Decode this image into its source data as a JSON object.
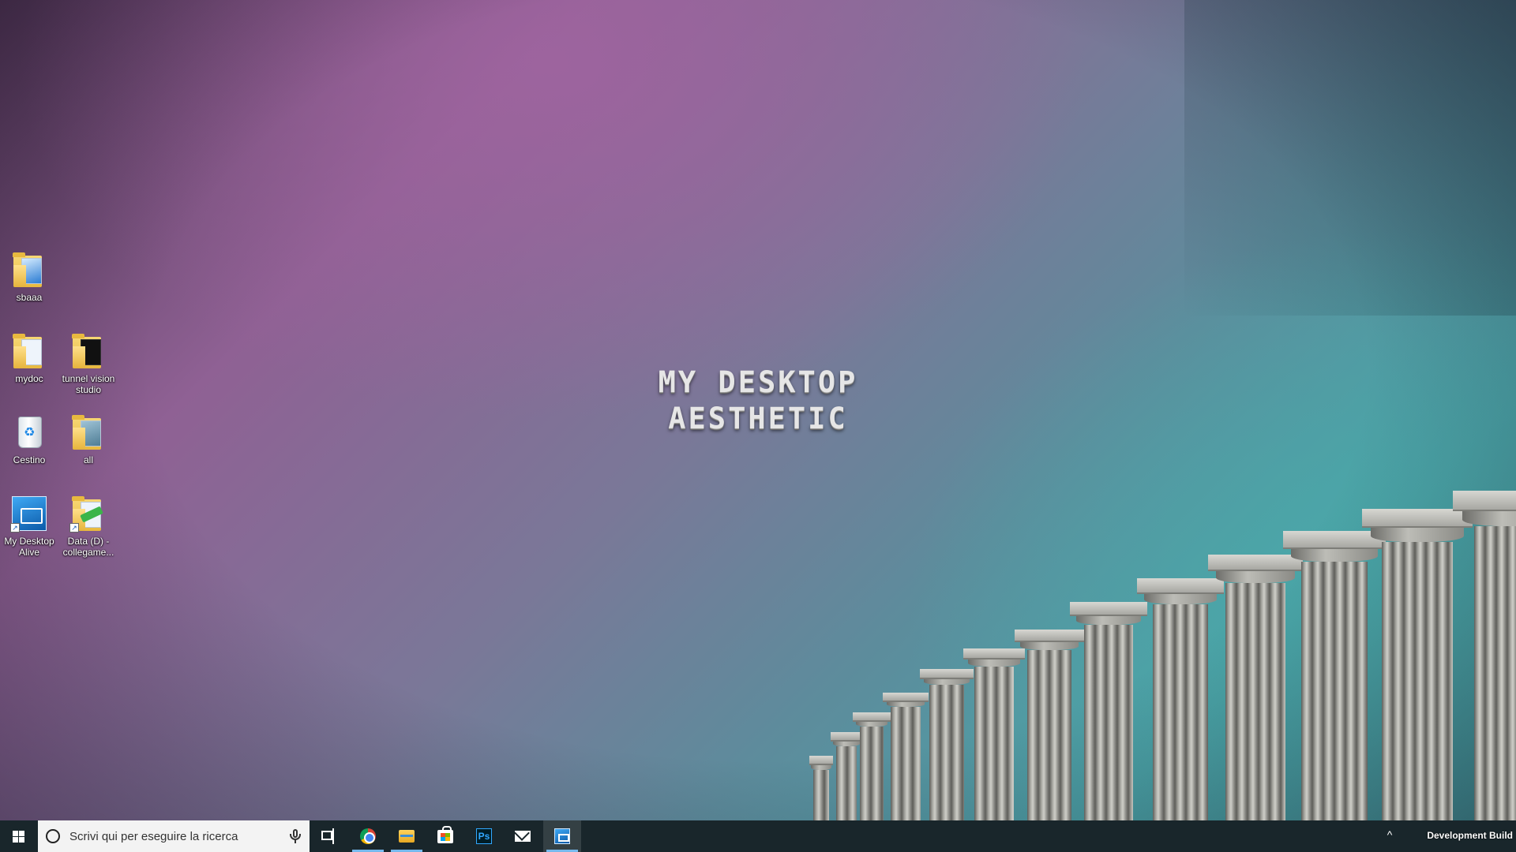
{
  "desktop": {
    "title_line1": "MY DESKTOP",
    "title_line2": "AESTHETIC",
    "icons": [
      {
        "label": "sbaaa"
      },
      {
        "label": "mydoc"
      },
      {
        "label": "tunnel vision studio"
      },
      {
        "label": "Cestino"
      },
      {
        "label": "all"
      },
      {
        "label": "My Desktop Alive"
      },
      {
        "label": "Data (D) - collegame..."
      }
    ]
  },
  "taskbar": {
    "search_placeholder": "Scrivi qui per eseguire la ricerca",
    "apps": [
      {
        "icon": "task-view-icon",
        "active": false
      },
      {
        "icon": "chrome-icon",
        "active": true
      },
      {
        "icon": "file-explorer-icon",
        "active": true
      },
      {
        "icon": "microsoft-store-icon",
        "active": false
      },
      {
        "icon": "photoshop-icon",
        "active": false,
        "label": "Ps"
      },
      {
        "icon": "mail-icon",
        "active": false
      },
      {
        "icon": "my-desktop-alive-icon",
        "active": true
      }
    ],
    "tray_chevron": "^",
    "watermark": "Development Build"
  },
  "colors": {
    "taskbar_bg": "#19262b",
    "active_indicator": "#76b9ed",
    "title_color": "#e6e6e6"
  }
}
